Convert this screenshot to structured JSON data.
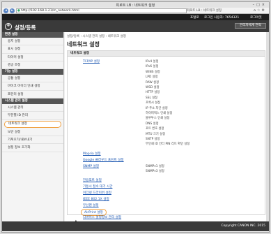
{
  "window": {
    "title": "피로트 LB : 네트워크 설정"
  },
  "toolbar": {
    "url": "http://192.168.1.21/m_network.html",
    "tab": "피로트 LB : 네트워크 설정"
  },
  "topbar": {
    "portal": "포털로",
    "login_user": "로그인 사용자: 7654321",
    "logout": "로그아웃"
  },
  "header": {
    "title": "설정/등록",
    "manager_mode": "관리자에게 연락"
  },
  "sidebar": {
    "section1": "환경 설정",
    "items1": [
      "용지 설정",
      "표시 설정",
      "타이머 설정",
      "경공 조정"
    ],
    "section2": "기능 설정",
    "items2": [
      "공통 설정",
      "마이크 어이더 인쇄 설정",
      "프린터 설정"
    ],
    "section3": "시스템 관리 설정",
    "items3": [
      "시스템 관리",
      "부문별 ID 관리",
      "네트워크 설정",
      "보안 설정",
      "가져오기/내보내기",
      "설정 정보 초기화"
    ]
  },
  "main": {
    "breadcrumb": "설정/등록 : 시스템 관리 설정 : 네트워크 설정",
    "title": "네트워크 설정",
    "box_title": "네트워크 설정",
    "tcpip": "TCP/IP 설정",
    "tcpip_sub": [
      "IPv4 설정",
      "IPv6 설정",
      "WINS 설정",
      "LPD 설정",
      "RAW 설정",
      "WSD 설정",
      "HTTP 설정",
      "SSL 설정",
      "프록시 설정",
      "IP 주소 차단 설정",
      "하이퍼텍스 인쇄 설정",
      "블루투스 인쇄 설정",
      "DNS 설정",
      "포트 번호 설정",
      "MTU 크기 설정",
      "SNTP 설정",
      "무인쇄 ID 인터 PIN 리트 확인 설정"
    ],
    "mopria": "Mopria 설정",
    "google": "Google 클라우드 프린트 설정",
    "snmp": "SNMP 설정",
    "snmp_sub": [
      "SNMPv1 설정",
      "SNMPv3 설정"
    ],
    "links2": [
      "전용포트 설정",
      "기동시 접속 대기 시간",
      "이더넷 드라이버 설정",
      "IEEE 802.1X 설정",
      "무선랜 설정",
      "AirPrint 설정",
      "디바이스 설정정보 관리 설정"
    ],
    "top_link": "▲"
  },
  "footer": {
    "copyright": "Copyright CANON INC. 2015"
  }
}
